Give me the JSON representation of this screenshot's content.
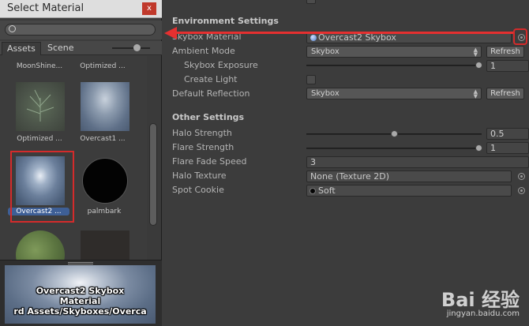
{
  "picker_window": {
    "title": "Select Material",
    "close_label": "x",
    "search_placeholder": "",
    "tabs": [
      {
        "label": "Assets"
      },
      {
        "label": "Scene"
      }
    ],
    "items": [
      {
        "name": "MoonShine..."
      },
      {
        "name": "Optimized ..."
      },
      {
        "name": "Optimized ..."
      },
      {
        "name": "Overcast1 ..."
      },
      {
        "name": "Overcast2 ..."
      },
      {
        "name": "palmbark"
      }
    ],
    "preview": {
      "line1": "Overcast2 Skybox",
      "line2": "Material",
      "line3": "rd Assets/Skyboxes/Overca"
    }
  },
  "inspector": {
    "env_title": "Environment Settings",
    "skybox_material": {
      "label": "Skybox Material",
      "value": "Overcast2 Skybox"
    },
    "ambient_mode": {
      "label": "Ambient Mode",
      "value": "Skybox",
      "button": "Refresh"
    },
    "skybox_exposure": {
      "label": "Skybox Exposure",
      "value": "1",
      "level": 1.0
    },
    "create_light": {
      "label": "Create Light"
    },
    "default_reflection": {
      "label": "Default Reflection",
      "value": "Skybox",
      "button": "Refresh"
    },
    "other_title": "Other Settings",
    "halo_strength": {
      "label": "Halo Strength",
      "value": "0.5",
      "level": 0.5
    },
    "flare_strength": {
      "label": "Flare Strength",
      "value": "1",
      "level": 1.0
    },
    "flare_fade_speed": {
      "label": "Flare Fade Speed",
      "value": "3"
    },
    "halo_texture": {
      "label": "Halo Texture",
      "value": "None (Texture 2D)"
    },
    "spot_cookie": {
      "label": "Spot Cookie",
      "value": "Soft"
    }
  },
  "watermark": {
    "logo": "Bai 经验",
    "url": "jingyan.baidu.com"
  },
  "colors": {
    "accent_red": "#e53030",
    "selection_blue": "#3e5f96",
    "panel": "#3c3c3c"
  }
}
